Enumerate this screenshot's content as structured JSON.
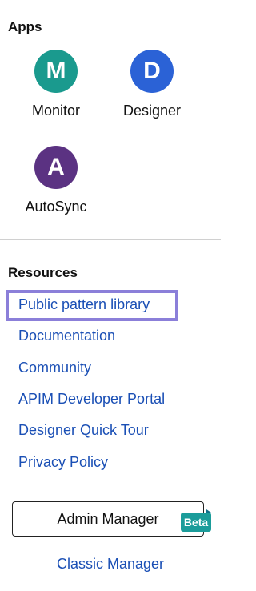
{
  "apps": {
    "heading": "Apps",
    "items": [
      {
        "letter": "M",
        "label": "Monitor",
        "color": "#1a9a8e"
      },
      {
        "letter": "D",
        "label": "Designer",
        "color": "#2b62d6"
      },
      {
        "letter": "A",
        "label": "AutoSync",
        "color": "#5b3282"
      }
    ]
  },
  "resources": {
    "heading": "Resources",
    "links": [
      "Public pattern library",
      "Documentation",
      "Community",
      "APIM Developer Portal",
      "Designer Quick Tour",
      "Privacy Policy"
    ]
  },
  "admin_manager": {
    "label": "Admin Manager",
    "badge": "Beta"
  },
  "classic_manager": {
    "label": "Classic Manager"
  },
  "colors": {
    "link": "#1a4fb5",
    "focus_outline": "#8b7fd9",
    "beta_badge": "#1b9c9a"
  }
}
